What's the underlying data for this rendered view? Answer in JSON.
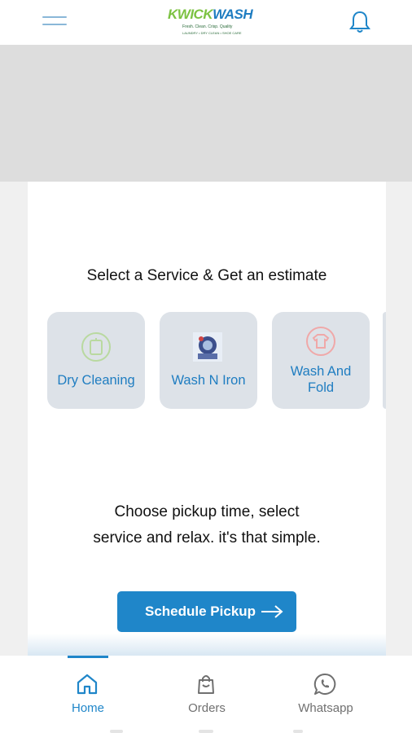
{
  "header": {
    "logo_k": "KWICK",
    "logo_wash": "WASH",
    "logo_tagline": "Fresh. Clean. Crisp. Quality",
    "logo_subline": "LAUNDRY • DRY CLEAN • SHOE CARE",
    "menu_icon": "hamburger-icon",
    "bell_icon": "bell-icon"
  },
  "main": {
    "section_title": "Select a Service & Get an estimate",
    "services": [
      {
        "label": "Dry Cleaning",
        "icon": "dry-cleaning-icon"
      },
      {
        "label": "Wash N Iron",
        "icon": "wash-n-iron-icon"
      },
      {
        "label": "Wash And Fold",
        "icon": "wash-and-fold-icon"
      }
    ],
    "tagline_line1": "Choose pickup time, select",
    "tagline_line2": "service and relax. it's that simple.",
    "cta_label": "Schedule Pickup"
  },
  "bottom_nav": {
    "items": [
      {
        "label": "Home",
        "icon": "home-icon",
        "active": true
      },
      {
        "label": "Orders",
        "icon": "shopping-bag-icon",
        "active": false
      },
      {
        "label": "Whatsapp",
        "icon": "whatsapp-icon",
        "active": false
      }
    ]
  },
  "colors": {
    "accent": "#1f86c9",
    "label_blue": "#1f7dc1",
    "card_tile": "#dde2e8",
    "inactive": "#707070"
  }
}
